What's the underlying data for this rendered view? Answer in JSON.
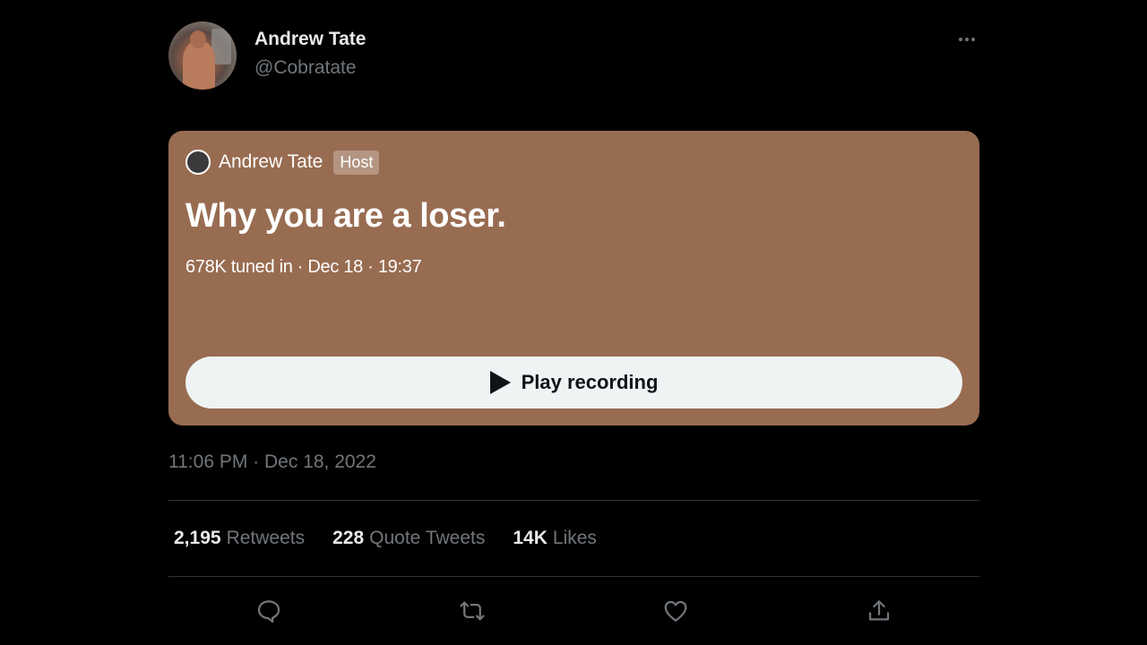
{
  "tweet": {
    "author": {
      "name": "Andrew Tate",
      "handle": "@Cobratate",
      "avatar_icon": "user-avatar-photo"
    },
    "more_icon": "more-horizontal-icon",
    "space": {
      "host_name": "Andrew Tate",
      "host_badge": "Host",
      "title": "Why you are a loser.",
      "meta": "678K tuned in · Dec 18 · 19:37",
      "play_label": "Play recording",
      "play_icon": "play-icon",
      "card_color": "#986c51"
    },
    "timestamp": "11:06 PM · Dec 18, 2022",
    "stats": {
      "retweets_count": "2,195",
      "retweets_label": "Retweets",
      "quotes_count": "228",
      "quotes_label": "Quote Tweets",
      "likes_count": "14K",
      "likes_label": "Likes"
    },
    "actions": [
      "reply-icon",
      "retweet-icon",
      "like-icon",
      "share-icon"
    ]
  }
}
